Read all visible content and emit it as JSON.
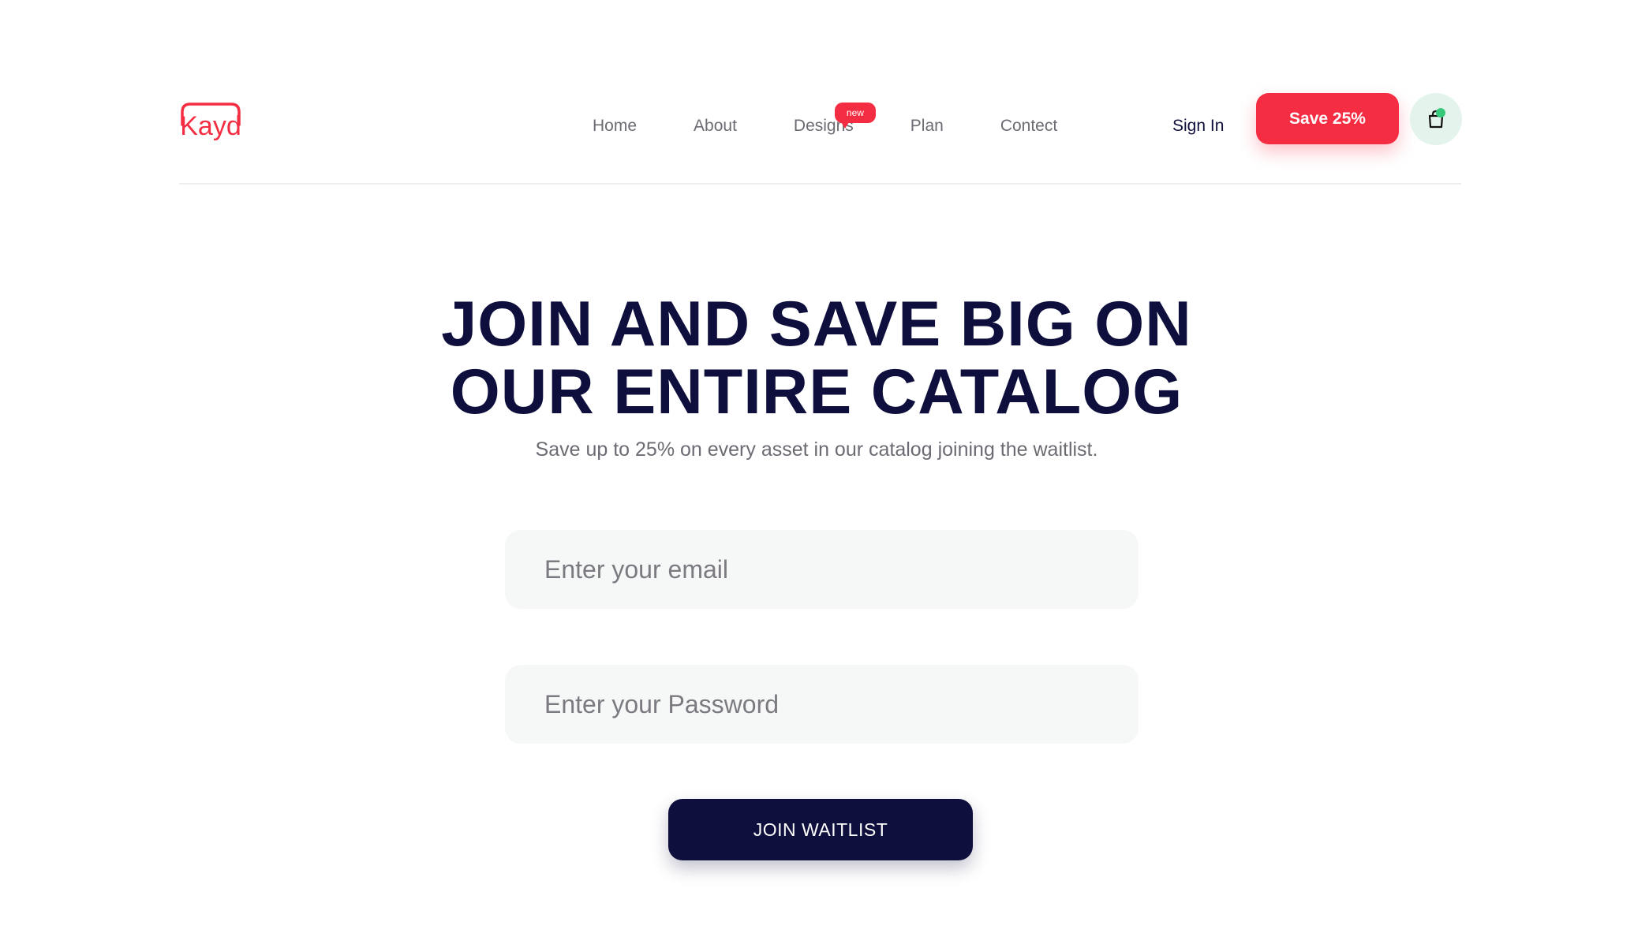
{
  "brand": {
    "logo_text": "Kayd",
    "accent_color": "#f52d43"
  },
  "nav": {
    "items": [
      {
        "label": "Home"
      },
      {
        "label": "About"
      },
      {
        "label": "Designs",
        "badge": "new"
      },
      {
        "label": "Plan"
      },
      {
        "label": "Contect"
      }
    ]
  },
  "header": {
    "signin_label": "Sign In",
    "save_label": "Save 25%",
    "cart_icon": "shopping-bag-icon",
    "cart_status_color": "#37c97a"
  },
  "hero": {
    "title_line1": "JOIN AND SAVE BIG ON",
    "title_line2": "OUR ENTIRE CATALOG",
    "subtitle": "Save up to 25% on every asset in our catalog joining the waitlist."
  },
  "form": {
    "email_placeholder": "Enter your email",
    "password_placeholder": "Enter your Password",
    "submit_label": "JOIN WAITLIST"
  },
  "colors": {
    "primary_dark": "#0f0f3d",
    "accent_red": "#f52d43",
    "input_bg": "#f6f7f7",
    "cart_bg": "#e4f3ec"
  }
}
